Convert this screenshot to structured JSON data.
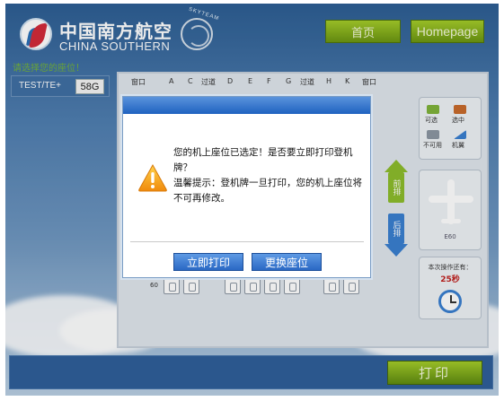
{
  "header": {
    "brand_cn": "中国南方航空",
    "brand_en": "CHINA SOUTHERN",
    "alliance_text": "SKYTEAM",
    "nav": {
      "home_cn": "首页",
      "home_en": "Homepage"
    }
  },
  "prompt": "请选择您的座位！",
  "flight": {
    "label": "TEST/TE+",
    "seat": "58G"
  },
  "seat_map": {
    "columns": [
      "窗口",
      "A",
      "C",
      "过道",
      "D",
      "E",
      "F",
      "G",
      "过道",
      "H",
      "K",
      "窗口"
    ],
    "row_number": "60",
    "legend": [
      {
        "label": "可选",
        "color": "#7fb23a"
      },
      {
        "label": "选中",
        "color": "#c86b2c"
      },
      {
        "label": "不可用",
        "color": "#8b96a2"
      },
      {
        "label": "机翼",
        "color": "#3a7fd0"
      }
    ],
    "front_label": "前排",
    "rear_label": "后排",
    "plane_label": "E60",
    "timer": {
      "label": "本次操作还有：",
      "value": "25秒"
    }
  },
  "dialog": {
    "message_lines": [
      "您的机上座位已选定！是否要立即打印登机牌？",
      "温馨提示：登机牌一旦打印，您的机上座位将不可再修改。"
    ],
    "print_now_label": "立即打印",
    "change_seat_label": "更换座位"
  },
  "footer": {
    "print_label": "打印"
  },
  "colors": {
    "accent_green": "#8cbc2c",
    "accent_blue": "#2a68c4",
    "timer_red": "#c0201e"
  }
}
